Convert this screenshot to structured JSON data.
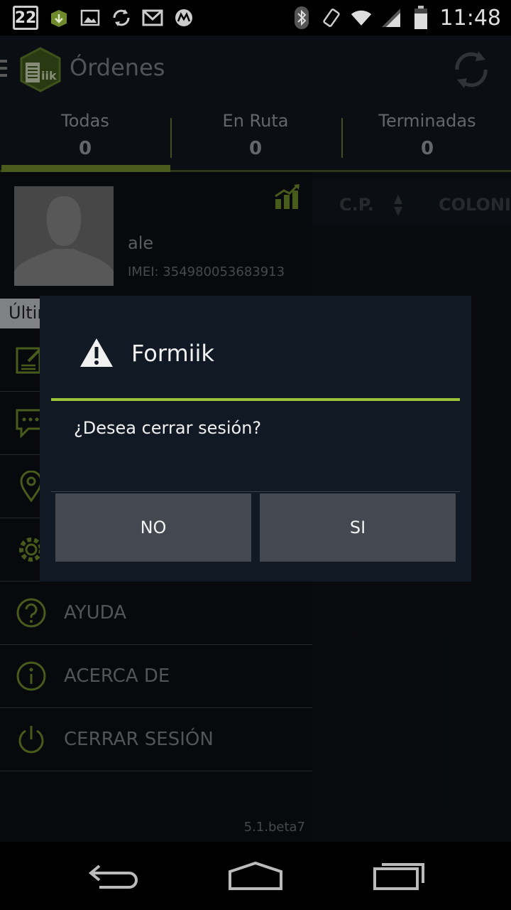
{
  "status_bar": {
    "date": "22",
    "time": "11:48",
    "left_icons": [
      "store-icon",
      "picture-icon",
      "sync-icon",
      "gmail-icon",
      "motorola-icon"
    ],
    "right_icons": [
      "bluetooth-icon",
      "vibrate-icon",
      "wifi-icon",
      "signal-icon",
      "battery-icon"
    ]
  },
  "action_bar": {
    "title": "Órdenes",
    "logo_text": "iik"
  },
  "tabs": [
    {
      "label": "Todas",
      "count": "0"
    },
    {
      "label": "En Ruta",
      "count": "0"
    },
    {
      "label": "Terminadas",
      "count": "0"
    }
  ],
  "table": {
    "columns": [
      "C.P.",
      "COLONIA"
    ]
  },
  "drawer": {
    "user_name": "ale",
    "imei": "IMEI: 354980053683913",
    "section_label": "Últim",
    "items": [
      {
        "label": "",
        "icon": "form-icon"
      },
      {
        "label": "",
        "icon": "chat-icon"
      },
      {
        "label": "",
        "icon": "location-icon"
      },
      {
        "label": "",
        "icon": "gear-icon"
      },
      {
        "label": "AYUDA",
        "icon": "help-icon"
      },
      {
        "label": "ACERCA DE",
        "icon": "info-icon"
      },
      {
        "label": "CERRAR SESIÓN",
        "icon": "power-icon"
      }
    ],
    "version": "5.1.beta7"
  },
  "dialog": {
    "title": "Formiik",
    "message": "¿Desea cerrar sesión?",
    "no_label": "NO",
    "yes_label": "SI"
  },
  "colors": {
    "accent": "#9cc23a",
    "icon_green": "#6f8a2c",
    "dialog_bg": "#111a24",
    "button_bg": "#434851"
  }
}
